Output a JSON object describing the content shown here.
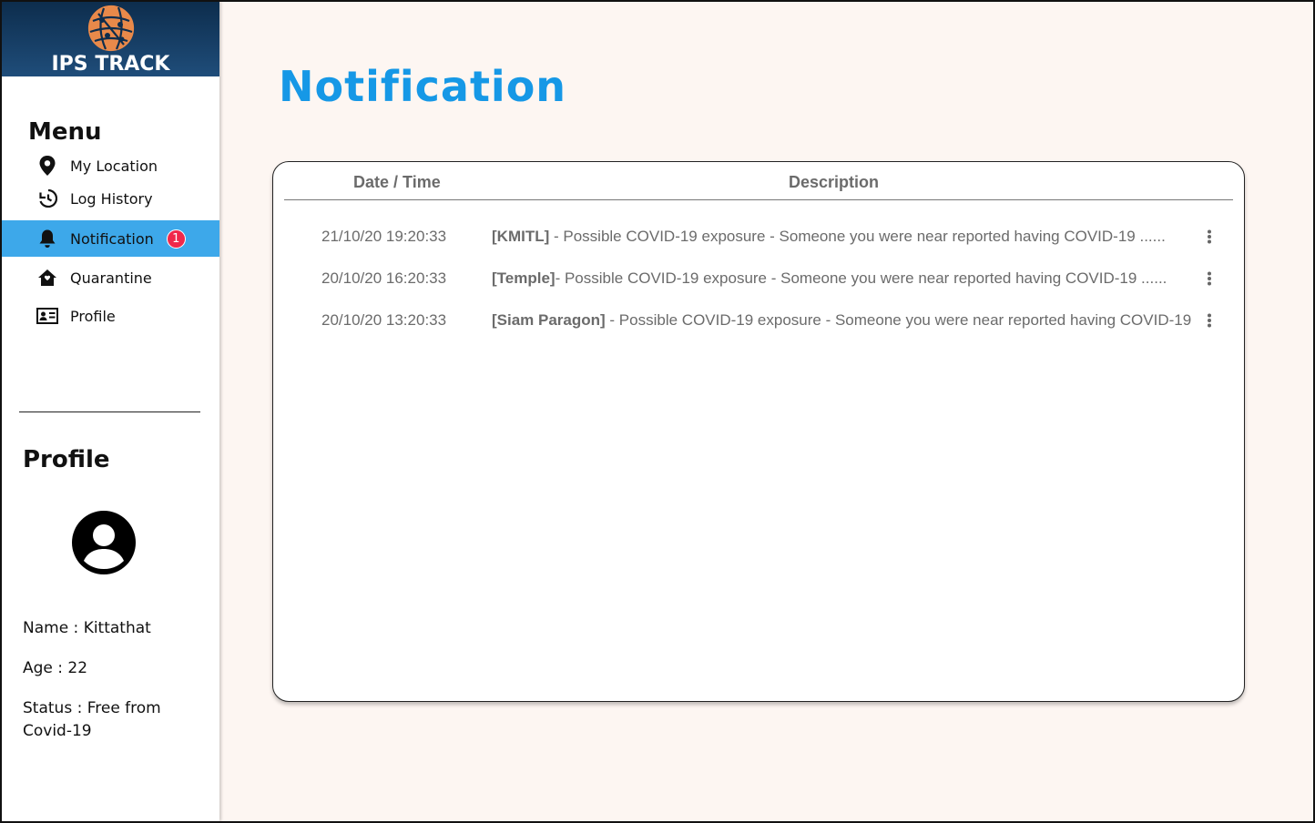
{
  "app": {
    "brand_name": "IPS TRACK"
  },
  "sidebar": {
    "menu_title": "Menu",
    "items": [
      {
        "label": "My Location",
        "icon": "location-pin-icon"
      },
      {
        "label": "Log History",
        "icon": "history-icon"
      },
      {
        "label": "Notification",
        "icon": "bell-icon",
        "badge": "1",
        "active": true
      },
      {
        "label": "Quarantine",
        "icon": "home-icon"
      },
      {
        "label": "Profile",
        "icon": "id-card-icon"
      }
    ],
    "profile_title": "Profile",
    "profile": {
      "name": "Name : Kittathat",
      "age": "Age : 22",
      "status": "Status : Free from Covid-19"
    }
  },
  "main": {
    "title": "Notification",
    "table": {
      "columns": [
        "Date / Time",
        "Description"
      ],
      "rows": [
        {
          "datetime": "21/10/20 19:20:33",
          "place": "[KMITL]",
          "text": " - Possible COVID-19 exposure - Someone you were near reported having COVID-19 ......"
        },
        {
          "datetime": "20/10/20 16:20:33",
          "place": "[Temple]",
          "text": "- Possible COVID-19 exposure - Someone you were near reported having COVID-19 ......"
        },
        {
          "datetime": "20/10/20 13:20:33",
          "place": "[Siam Paragon]",
          "text": " - Possible COVID-19 exposure - Someone you were near reported having COVID-19 .."
        }
      ]
    }
  },
  "colors": {
    "accent": "#1698e6",
    "active_item": "#3da8ea",
    "badge": "#f0284a",
    "brand_bg": "#0d2d4d",
    "logo": "#e8894a",
    "page_bg": "#fdf6f2"
  }
}
